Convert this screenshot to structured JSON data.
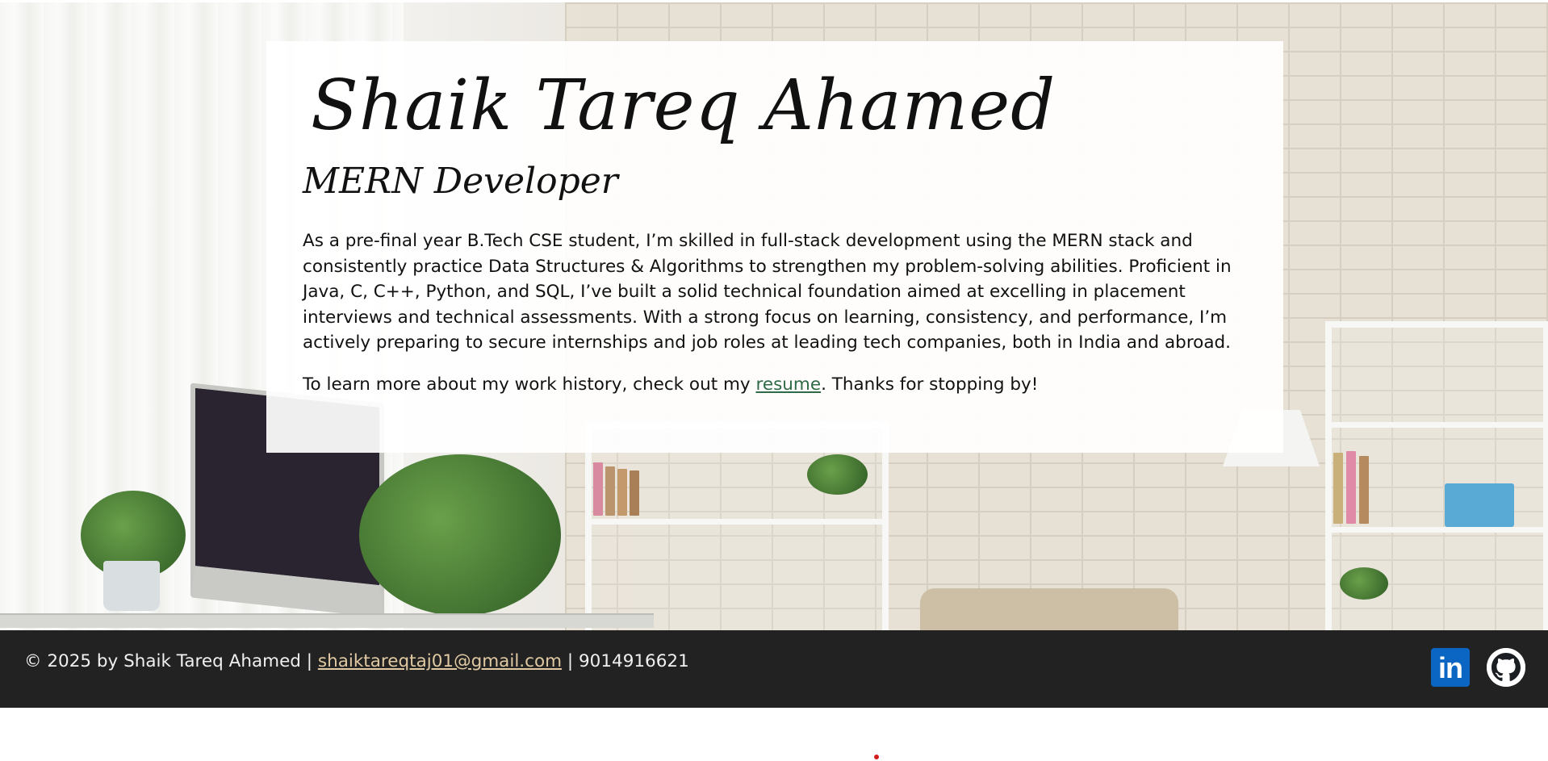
{
  "hero": {
    "name": "Shaik Tareq Ahamed",
    "role": "MERN Developer",
    "bio": "As a pre-final year B.Tech CSE student, I’m skilled in full-stack development using the MERN stack and consistently practice Data Structures & Algorithms to strengthen my problem-solving abilities. Proficient in Java, C, C++, Python, and SQL, I’ve built a solid technical foundation aimed at excelling in placement interviews and technical assessments. With a strong focus on learning, consistency, and performance, I’m actively preparing to secure internships and job roles at leading tech companies, both in India and abroad.",
    "outro_before": "To learn more about my work history, check out my ",
    "resume_label": "resume",
    "outro_after": ". Thanks for stopping by!"
  },
  "footer": {
    "copyright": "© 2025 by Shaik Tareq Ahamed | ",
    "email": "shaiktareqtaj01@gmail.com",
    "separator": " | ",
    "phone": "9014916621",
    "linkedin_label": "in",
    "linkedin_icon": "linkedin-icon",
    "github_icon": "github-icon"
  },
  "colors": {
    "footer_bg": "#222222",
    "link_green": "#2e6b46",
    "email_link": "#e0c9a3",
    "linkedin_blue": "#0a66c2"
  }
}
